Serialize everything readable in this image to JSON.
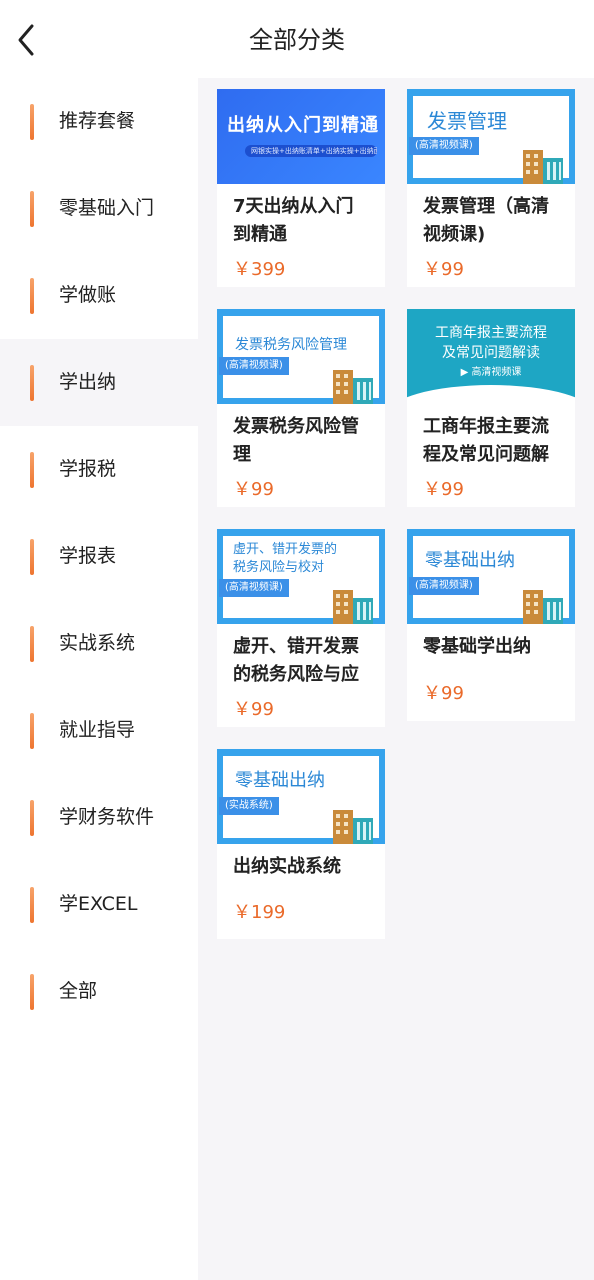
{
  "header": {
    "title": "全部分类",
    "back_icon": "chevron-left-icon"
  },
  "sidebar": {
    "items": [
      {
        "label": "推荐套餐"
      },
      {
        "label": "零基础入门"
      },
      {
        "label": "学做账"
      },
      {
        "label": "学出纳",
        "active": true
      },
      {
        "label": "学报税"
      },
      {
        "label": "学报表"
      },
      {
        "label": "实战系统"
      },
      {
        "label": "就业指导"
      },
      {
        "label": "学财务软件"
      },
      {
        "label": "学EXCEL"
      },
      {
        "label": "全部"
      }
    ]
  },
  "courses": [
    {
      "title_l1": "7天出纳从入门",
      "title_l2": "到精通",
      "price": "￥399",
      "thumb": {
        "style": "blue",
        "heading": "出纳从入门到精通",
        "subtitle": "网银实操+出纳账清单+出纳实操+出纳面试技巧"
      }
    },
    {
      "title_l1": "发票管理（高清",
      "title_l2": "视频课)",
      "price": "￥99",
      "thumb": {
        "style": "frame",
        "heading": "发票管理",
        "tag": "(高清视频课)"
      }
    },
    {
      "title_l1": "发票税务风险管",
      "title_l2": "理",
      "price": "￥99",
      "thumb": {
        "style": "frame",
        "heading": "发票税务风险管理",
        "tag": "(高清视频课)"
      }
    },
    {
      "title_l1": "工商年报主要流",
      "title_l2": "程及常见问题解",
      "price": "￥99",
      "thumb": {
        "style": "teal",
        "line1": "工商年报主要流程",
        "line2": "及常见问题解读",
        "video": "高清视频课"
      }
    },
    {
      "title_l1": "虚开、错开发票",
      "title_l2": "的税务风险与应",
      "price": "￥99",
      "thumb": {
        "style": "frame",
        "heading_l1": "虚开、错开发票的",
        "heading_l2": "税务风险与校对",
        "tag": "(高清视频课)"
      }
    },
    {
      "title_l1": "零基础学出纳",
      "title_l2": "",
      "price": "￥99",
      "thumb": {
        "style": "frame",
        "heading": "零基础出纳",
        "tag": "(高清视频课)"
      }
    },
    {
      "title_l1": "出纳实战系统",
      "title_l2": "",
      "price": "￥199",
      "thumb": {
        "style": "frame",
        "heading": "零基础出纳",
        "tag": "(实战系统)"
      }
    }
  ],
  "colors": {
    "accent": "#ea6a2a",
    "indicator": "#ee7530",
    "panel_bg": "#f6f5f8",
    "thumb_blue": "#36a3ec"
  }
}
